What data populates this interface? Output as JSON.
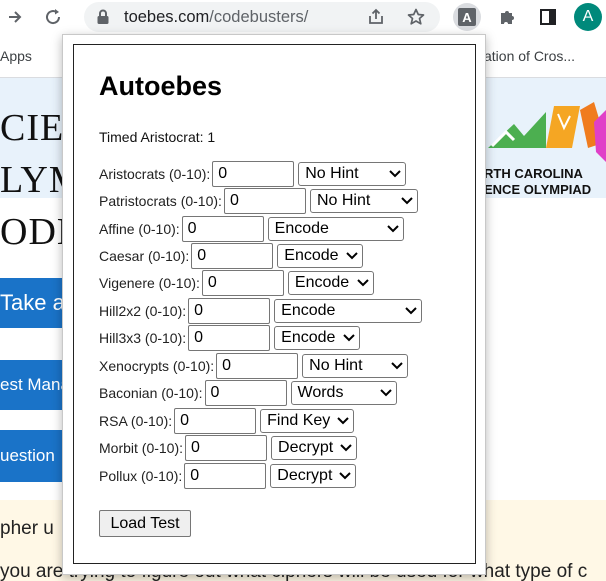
{
  "browser": {
    "url_host": "toebes.com",
    "url_path": "/codebusters/",
    "bookmark_apps": "Apps",
    "bookmark_right": "ation of Cros...",
    "ext_letter": "A",
    "avatar_letter": "A"
  },
  "page": {
    "hero_lines": [
      "CIEN",
      "LYM",
      "ODE"
    ],
    "buttons": [
      "Take a",
      "est Mana",
      "uestion"
    ],
    "logo_line1": "RTH CAROLINA",
    "logo_line2": "ENCE OLYMPIAD",
    "line_1": "pher u",
    "line_2": "you are trying to figure out what ciphers will be used for what type of c"
  },
  "extension": {
    "title": "Autoebes",
    "timed_label": "Timed Aristocrat: 1",
    "rows": [
      {
        "label": "Aristocrats (0-10):",
        "value": "0",
        "option": "No Hint"
      },
      {
        "label": "Patristocrats (0-10):",
        "value": "0",
        "option": "No Hint"
      },
      {
        "label": "Affine (0-10):",
        "value": "0",
        "option": "Encode"
      },
      {
        "label": "Caesar (0-10):",
        "value": "0",
        "option": "Encode"
      },
      {
        "label": "Vigenere (0-10):",
        "value": "0",
        "option": "Encode"
      },
      {
        "label": "Hill2x2 (0-10):",
        "value": "0",
        "option": "Encode"
      },
      {
        "label": "Hill3x3 (0-10):",
        "value": "0",
        "option": "Encode"
      },
      {
        "label": "Xenocrypts (0-10):",
        "value": "0",
        "option": "No Hint"
      },
      {
        "label": "Baconian (0-10):",
        "value": "0",
        "option": "Words"
      },
      {
        "label": "RSA (0-10):",
        "value": "0",
        "option": "Find Key"
      },
      {
        "label": "Morbit (0-10):",
        "value": "0",
        "option": "Decrypt"
      },
      {
        "label": "Pollux (0-10):",
        "value": "0",
        "option": "Decrypt"
      }
    ],
    "load_button": "Load Test"
  },
  "colors": {
    "accent_blue": "#1a73c8",
    "avatar": "#00897b"
  }
}
